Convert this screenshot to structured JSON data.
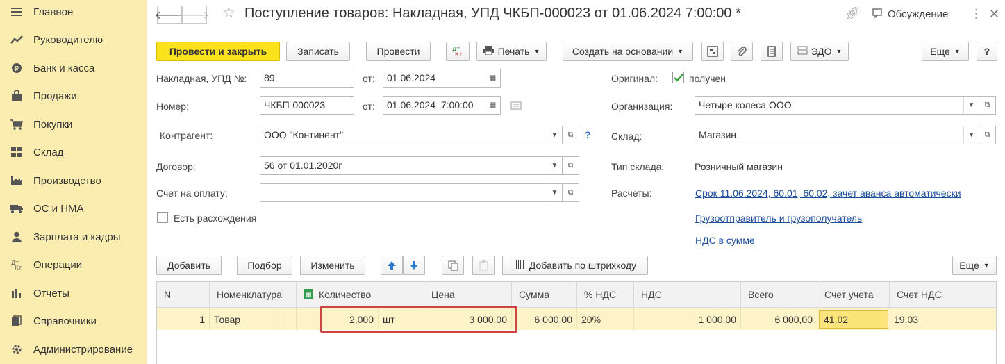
{
  "sidebar": {
    "items": [
      {
        "label": "Главное",
        "icon": "menu-icon"
      },
      {
        "label": "Руководителю",
        "icon": "trend-icon"
      },
      {
        "label": "Банк и касса",
        "icon": "coin-icon"
      },
      {
        "label": "Продажи",
        "icon": "bag-icon"
      },
      {
        "label": "Покупки",
        "icon": "cart-icon"
      },
      {
        "label": "Склад",
        "icon": "warehouse-icon"
      },
      {
        "label": "Производство",
        "icon": "factory-icon"
      },
      {
        "label": "ОС и НМА",
        "icon": "truck-icon"
      },
      {
        "label": "Зарплата и кадры",
        "icon": "person-icon"
      },
      {
        "label": "Операции",
        "icon": "dt-kt-icon"
      },
      {
        "label": "Отчеты",
        "icon": "bar-chart-icon"
      },
      {
        "label": "Справочники",
        "icon": "books-icon"
      },
      {
        "label": "Администрирование",
        "icon": "gear-icon"
      }
    ]
  },
  "header": {
    "title": "Поступление товаров: Накладная, УПД ЧКБП-000023 от 01.06.2024 7:00:00 *",
    "discussion": "Обсуждение"
  },
  "toolbar": {
    "post_close": "Провести и закрыть",
    "save": "Записать",
    "post": "Провести",
    "dtkt": "Дт Кт",
    "print": "Печать",
    "create_based": "Создать на основании",
    "edo": "ЭДО",
    "more": "Еще",
    "help": "?"
  },
  "form": {
    "invoice_label": "Накладная, УПД №:",
    "invoice_no": "89",
    "from_label": "от:",
    "invoice_date": "01.06.2024",
    "number_label": "Номер:",
    "number": "ЧКБП-000023",
    "number_date": "01.06.2024  7:00:00",
    "counterparty_label": "Контрагент:",
    "counterparty": "ООО \"Континент\"",
    "contract_label": "Договор:",
    "contract": "56 от 01.01.2020г",
    "payment_label": "Счет на оплату:",
    "payment": "",
    "discrepancy_label": "Есть расхождения",
    "original_label": "Оригинал:",
    "original_value": "получен",
    "org_label": "Организация:",
    "org": "Четыре колеса ООО",
    "warehouse_label": "Склад:",
    "warehouse": "Магазин",
    "warehouse_type_label": "Тип склада:",
    "warehouse_type": "Розничный магазин",
    "settlements_label": "Расчеты:",
    "settlements_link": "Срок 11.06.2024, 60.01, 60.02, зачет аванса автоматически",
    "shipper_link": "Грузоотправитель и грузополучатель",
    "vat_link": "НДС в сумме"
  },
  "table_toolbar": {
    "add": "Добавить",
    "select": "Подбор",
    "edit": "Изменить",
    "barcode": "Добавить по штрихкоду",
    "more": "Еще"
  },
  "table": {
    "headers": [
      "N",
      "Номенклатура",
      "Количество",
      "Цена",
      "Сумма",
      "% НДС",
      "НДС",
      "Всего",
      "Счет учета",
      "Счет НДС"
    ],
    "rows": [
      {
        "n": "1",
        "item": "Товар",
        "qty": "2,000",
        "unit": "шт",
        "price": "3 000,00",
        "sum": "6 000,00",
        "vat_rate": "20%",
        "vat": "1 000,00",
        "total": "6 000,00",
        "account": "41.02",
        "vat_account": "19.03"
      }
    ]
  }
}
